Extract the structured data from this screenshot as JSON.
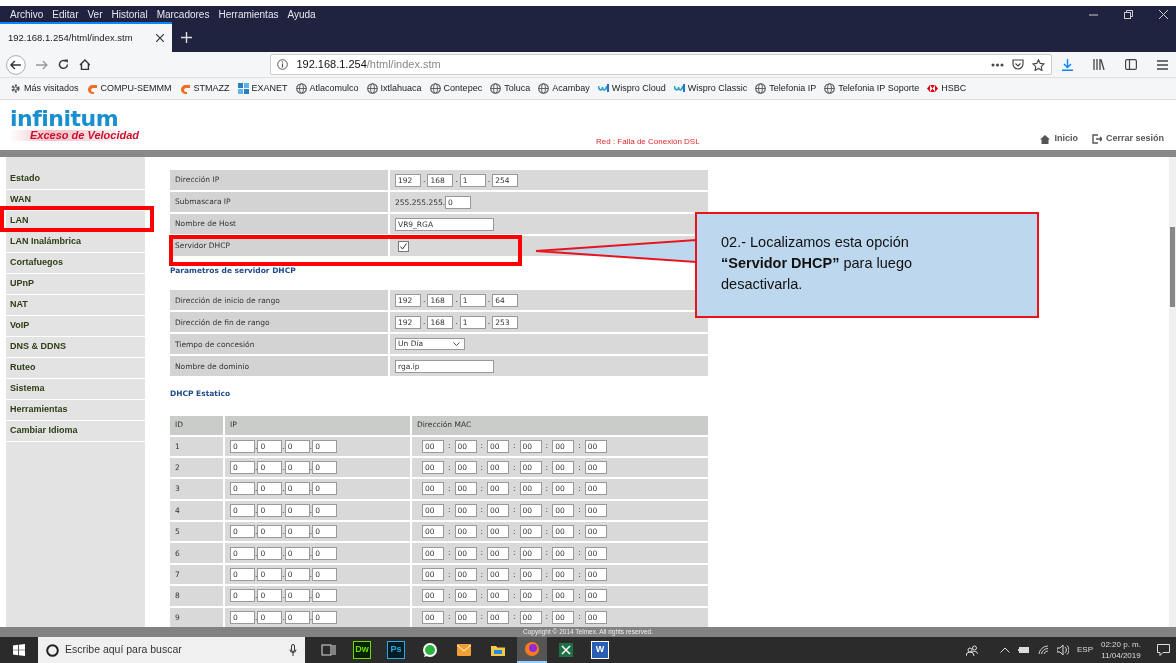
{
  "browser": {
    "menu": [
      "Archivo",
      "Editar",
      "Ver",
      "Historial",
      "Marcadores",
      "Herramientas",
      "Ayuda"
    ],
    "tab": {
      "title": "192.168.1.254/html/index.stm",
      "selected": true
    },
    "url": {
      "host": "192.168.1.254",
      "path": "/html/index.stm"
    },
    "bookmarks": [
      {
        "label": "Más visitados",
        "kind": "gear"
      },
      {
        "label": "COMPU-SEMMM",
        "kind": "cp"
      },
      {
        "label": "STMAZZ",
        "kind": "cp"
      },
      {
        "label": "EXANET",
        "kind": "exanet"
      },
      {
        "label": "Atlacomulco",
        "kind": "globe"
      },
      {
        "label": "Ixtlahuaca",
        "kind": "globe"
      },
      {
        "label": "Contepec",
        "kind": "globe"
      },
      {
        "label": "Toluca",
        "kind": "globe"
      },
      {
        "label": "Acambay",
        "kind": "globe"
      },
      {
        "label": "Wispro Cloud",
        "kind": "wispro"
      },
      {
        "label": "Wispro Classic",
        "kind": "wispro"
      },
      {
        "label": "Telefonia IP",
        "kind": "globe"
      },
      {
        "label": "Telefonia IP Soporte",
        "kind": "globe"
      },
      {
        "label": "HSBC",
        "kind": "hsbc"
      }
    ]
  },
  "header": {
    "logo": "infinitum",
    "slogan": "Exceso de Velocidad",
    "status": "Red : Falla de Conexión DSL",
    "links": [
      {
        "label": "Inicio",
        "kind": "home"
      },
      {
        "label": "Cerrar sesión",
        "kind": "logout"
      }
    ]
  },
  "sidebar": [
    "Estado",
    "WAN",
    "LAN",
    "LAN Inalámbrica",
    "Cortafuegos",
    "UPnP",
    "NAT",
    "VoIP",
    "DNS & DDNS",
    "Ruteo",
    "Sistema",
    "Herramientas",
    "Cambiar Idioma"
  ],
  "lan_settings": [
    {
      "label": "Dirección IP",
      "kind": "ip",
      "values": [
        "192",
        "168",
        "1",
        "254"
      ]
    },
    {
      "label": "Submascara IP",
      "kind": "mask",
      "prefix": "255.255.255.",
      "values": [
        "0"
      ]
    },
    {
      "label": "Nombre de Host",
      "kind": "text",
      "value": "VR9_RGA"
    },
    {
      "label": "Servidor DHCP",
      "kind": "checkbox",
      "checked": true
    }
  ],
  "dhcp_title": "Parametros de servidor DHCP",
  "dhcp_settings": [
    {
      "label": "Dirección de inicio de rango",
      "kind": "ip",
      "values": [
        "192",
        "168",
        "1",
        "64"
      ]
    },
    {
      "label": "Dirección de fin de rango",
      "kind": "ip",
      "values": [
        "192",
        "168",
        "1",
        "253"
      ]
    },
    {
      "label": "Tiempo de concesión",
      "kind": "select",
      "value": "Un Día"
    },
    {
      "label": "Nombre de dominio",
      "kind": "text",
      "value": "rga.ip"
    }
  ],
  "static_title": "DHCP Estatico",
  "static_table": {
    "columns": [
      "ID",
      "IP",
      "Dirección MAC"
    ],
    "rows": [
      {
        "id": "1",
        "ip": [
          "0",
          "0",
          "0",
          "0"
        ],
        "mac": [
          "00",
          "00",
          "00",
          "00",
          "00",
          "00"
        ]
      },
      {
        "id": "2",
        "ip": [
          "0",
          "0",
          "0",
          "0"
        ],
        "mac": [
          "00",
          "00",
          "00",
          "00",
          "00",
          "00"
        ]
      },
      {
        "id": "3",
        "ip": [
          "0",
          "0",
          "0",
          "0"
        ],
        "mac": [
          "00",
          "00",
          "00",
          "00",
          "00",
          "00"
        ]
      },
      {
        "id": "4",
        "ip": [
          "0",
          "0",
          "0",
          "0"
        ],
        "mac": [
          "00",
          "00",
          "00",
          "00",
          "00",
          "00"
        ]
      },
      {
        "id": "5",
        "ip": [
          "0",
          "0",
          "0",
          "0"
        ],
        "mac": [
          "00",
          "00",
          "00",
          "00",
          "00",
          "00"
        ]
      },
      {
        "id": "6",
        "ip": [
          "0",
          "0",
          "0",
          "0"
        ],
        "mac": [
          "00",
          "00",
          "00",
          "00",
          "00",
          "00"
        ]
      },
      {
        "id": "7",
        "ip": [
          "0",
          "0",
          "0",
          "0"
        ],
        "mac": [
          "00",
          "00",
          "00",
          "00",
          "00",
          "00"
        ]
      },
      {
        "id": "8",
        "ip": [
          "0",
          "0",
          "0",
          "0"
        ],
        "mac": [
          "00",
          "00",
          "00",
          "00",
          "00",
          "00"
        ]
      },
      {
        "id": "9",
        "ip": [
          "0",
          "0",
          "0",
          "0"
        ],
        "mac": [
          "00",
          "00",
          "00",
          "00",
          "00",
          "00"
        ]
      }
    ]
  },
  "ip_separator": ".",
  "mac_separator": ":",
  "footer": "Copyright © 2014 Telmex. All rights reserved.",
  "annotation": {
    "text": "02.- Localizamos esta opción **“Servidor DHCP”** para luego desactivarla."
  },
  "taskbar": {
    "search_placeholder": "Escribe aquí para buscar",
    "apps": [
      {
        "kind": "taskview",
        "active": false
      },
      {
        "kind": "dw",
        "label": "Dw",
        "active": false
      },
      {
        "kind": "ps",
        "label": "Ps",
        "active": false
      },
      {
        "kind": "whatsapp",
        "active": false
      },
      {
        "kind": "outlook",
        "active": false
      },
      {
        "kind": "explorer",
        "active": false
      },
      {
        "kind": "firefox",
        "active": true
      },
      {
        "kind": "excel",
        "active": false
      },
      {
        "kind": "word",
        "label": "W",
        "active": false
      }
    ],
    "language": "ESP",
    "time": "02:20 p. m.",
    "date": "11/04/2019"
  }
}
